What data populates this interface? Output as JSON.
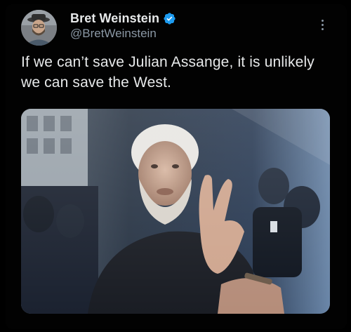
{
  "tweet": {
    "author": {
      "display_name": "Bret Weinstein",
      "handle": "@BretWeinstein",
      "verified_badge_icon": "verified-badge-icon",
      "avatar_description_icon": "avatar"
    },
    "text": "If we can’t save Julian Assange, it is unlikely we can save the West.",
    "menu_icon": "more-options-icon",
    "media": {
      "kind": "photo"
    }
  },
  "colors": {
    "background": "#000000",
    "primary_text": "#e7e9ea",
    "secondary_text": "#8b98a5",
    "verified_blue": "#1d9bf0"
  }
}
